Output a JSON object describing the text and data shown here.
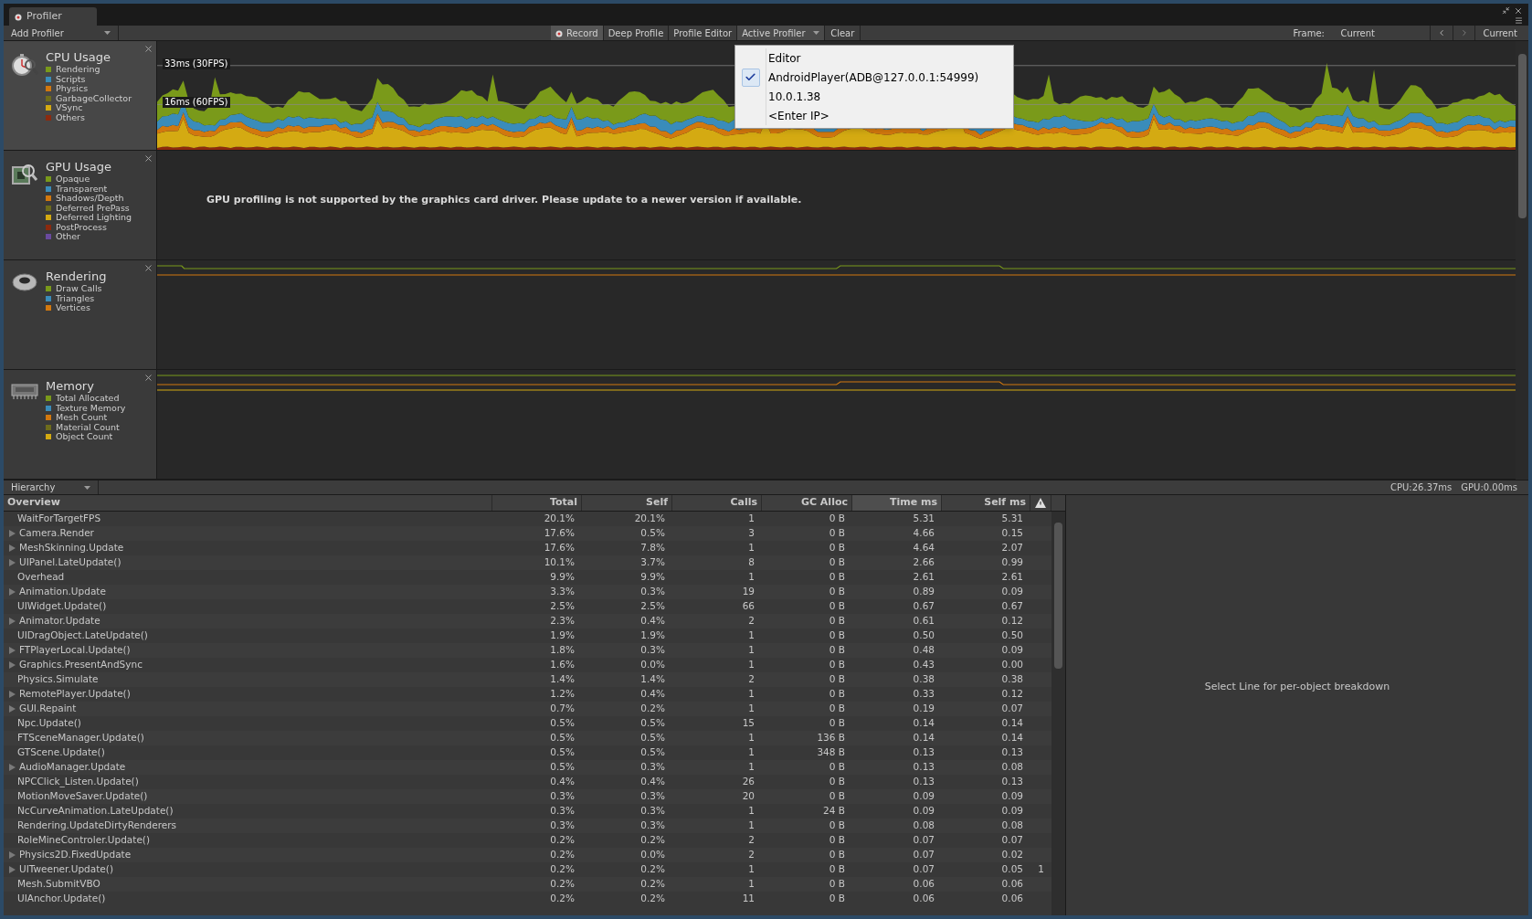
{
  "window": {
    "tab_title": "Profiler"
  },
  "toolbar": {
    "add_profiler": "Add Profiler",
    "buttons": [
      {
        "label": "Record",
        "on": true
      },
      {
        "label": "Deep Profile",
        "on": false
      },
      {
        "label": "Profile Editor",
        "on": false
      }
    ],
    "active_profiler": {
      "label": "Active Profiler",
      "expanded": true
    },
    "clear": "Clear",
    "frame_label": "Frame:",
    "frame_value": "Current",
    "current_button": "Current"
  },
  "profiler_menu": [
    {
      "label": "Editor",
      "selected": false
    },
    {
      "label": "AndroidPlayer(ADB@127.0.0.1:54999)",
      "selected": true
    },
    {
      "label": "10.0.1.38",
      "selected": false
    },
    {
      "label": "<Enter IP>",
      "selected": false
    }
  ],
  "areas": [
    {
      "kind": "cpu",
      "title": "CPU Usage",
      "chart_labels": [
        "33ms (30FPS)",
        "16ms (60FPS)"
      ],
      "legend": [
        {
          "label": "Rendering",
          "color": "#7a9a1a"
        },
        {
          "label": "Scripts",
          "color": "#3a8cba"
        },
        {
          "label": "Physics",
          "color": "#d2780e"
        },
        {
          "label": "GarbageCollector",
          "color": "#6e6c1c"
        },
        {
          "label": "VSync",
          "color": "#d4aa12"
        },
        {
          "label": "Others",
          "color": "#8c2a0e"
        }
      ]
    },
    {
      "kind": "gpu",
      "title": "GPU Usage",
      "message": "GPU profiling is not supported by the graphics card driver. Please update to a newer version if available.",
      "legend": [
        {
          "label": "Opaque",
          "color": "#7a9a1a"
        },
        {
          "label": "Transparent",
          "color": "#3a8cba"
        },
        {
          "label": "Shadows/Depth",
          "color": "#d2780e"
        },
        {
          "label": "Deferred PrePass",
          "color": "#6e6c1c"
        },
        {
          "label": "Deferred Lighting",
          "color": "#d4aa12"
        },
        {
          "label": "PostProcess",
          "color": "#8c2a0e"
        },
        {
          "label": "Other",
          "color": "#6a4a9e"
        }
      ]
    },
    {
      "kind": "rendering",
      "title": "Rendering",
      "legend": [
        {
          "label": "Draw Calls",
          "color": "#7a9a1a"
        },
        {
          "label": "Triangles",
          "color": "#3a8cba"
        },
        {
          "label": "Vertices",
          "color": "#d2780e"
        }
      ]
    },
    {
      "kind": "memory",
      "title": "Memory",
      "legend": [
        {
          "label": "Total Allocated",
          "color": "#7a9a1a"
        },
        {
          "label": "Texture Memory",
          "color": "#3a8cba"
        },
        {
          "label": "Mesh Count",
          "color": "#d2780e"
        },
        {
          "label": "Material Count",
          "color": "#6e6c1c"
        },
        {
          "label": "Object Count",
          "color": "#d4aa12"
        }
      ]
    }
  ],
  "hierarchy": {
    "view": "Hierarchy",
    "cpu_time": "CPU:26.37ms",
    "gpu_time": "GPU:0.00ms",
    "detail_message": "Select Line for per-object breakdown",
    "columns": [
      {
        "kind": "name",
        "label": "Overview",
        "selected": false
      },
      {
        "kind": "number",
        "label": "Total",
        "selected": false
      },
      {
        "kind": "number",
        "label": "Self",
        "selected": false
      },
      {
        "kind": "number",
        "label": "Calls",
        "selected": false
      },
      {
        "kind": "number",
        "label": "GC Alloc",
        "selected": false
      },
      {
        "kind": "number",
        "label": "Time ms",
        "selected": true
      },
      {
        "kind": "number",
        "label": "Self ms",
        "selected": false
      },
      {
        "kind": "warning",
        "selected": false
      }
    ],
    "rows": [
      {
        "has_children": false,
        "cells": [
          "WaitForTargetFPS",
          "20.1%",
          "20.1%",
          "1",
          "0 B",
          "5.31",
          "5.31"
        ]
      },
      {
        "has_children": true,
        "cells": [
          "Camera.Render",
          "17.6%",
          "0.5%",
          "3",
          "0 B",
          "4.66",
          "0.15"
        ]
      },
      {
        "has_children": true,
        "cells": [
          "MeshSkinning.Update",
          "17.6%",
          "7.8%",
          "1",
          "0 B",
          "4.64",
          "2.07"
        ]
      },
      {
        "has_children": true,
        "cells": [
          "UIPanel.LateUpdate()",
          "10.1%",
          "3.7%",
          "8",
          "0 B",
          "2.66",
          "0.99"
        ]
      },
      {
        "has_children": false,
        "cells": [
          "Overhead",
          "9.9%",
          "9.9%",
          "1",
          "0 B",
          "2.61",
          "2.61"
        ]
      },
      {
        "has_children": true,
        "cells": [
          "Animation.Update",
          "3.3%",
          "0.3%",
          "19",
          "0 B",
          "0.89",
          "0.09"
        ]
      },
      {
        "has_children": false,
        "cells": [
          "UIWidget.Update()",
          "2.5%",
          "2.5%",
          "66",
          "0 B",
          "0.67",
          "0.67"
        ]
      },
      {
        "has_children": true,
        "cells": [
          "Animator.Update",
          "2.3%",
          "0.4%",
          "2",
          "0 B",
          "0.61",
          "0.12"
        ]
      },
      {
        "has_children": false,
        "cells": [
          "UIDragObject.LateUpdate()",
          "1.9%",
          "1.9%",
          "1",
          "0 B",
          "0.50",
          "0.50"
        ]
      },
      {
        "has_children": true,
        "cells": [
          "FTPlayerLocal.Update()",
          "1.8%",
          "0.3%",
          "1",
          "0 B",
          "0.48",
          "0.09"
        ]
      },
      {
        "has_children": true,
        "cells": [
          "Graphics.PresentAndSync",
          "1.6%",
          "0.0%",
          "1",
          "0 B",
          "0.43",
          "0.00"
        ]
      },
      {
        "has_children": false,
        "cells": [
          "Physics.Simulate",
          "1.4%",
          "1.4%",
          "2",
          "0 B",
          "0.38",
          "0.38"
        ]
      },
      {
        "has_children": true,
        "cells": [
          "RemotePlayer.Update()",
          "1.2%",
          "0.4%",
          "1",
          "0 B",
          "0.33",
          "0.12"
        ]
      },
      {
        "has_children": true,
        "cells": [
          "GUI.Repaint",
          "0.7%",
          "0.2%",
          "1",
          "0 B",
          "0.19",
          "0.07"
        ]
      },
      {
        "has_children": false,
        "cells": [
          "Npc.Update()",
          "0.5%",
          "0.5%",
          "15",
          "0 B",
          "0.14",
          "0.14"
        ]
      },
      {
        "has_children": false,
        "cells": [
          "FTSceneManager.Update()",
          "0.5%",
          "0.5%",
          "1",
          "136 B",
          "0.14",
          "0.14"
        ]
      },
      {
        "has_children": false,
        "cells": [
          "GTScene.Update()",
          "0.5%",
          "0.5%",
          "1",
          "348 B",
          "0.13",
          "0.13"
        ]
      },
      {
        "has_children": true,
        "cells": [
          "AudioManager.Update",
          "0.5%",
          "0.3%",
          "1",
          "0 B",
          "0.13",
          "0.08"
        ]
      },
      {
        "has_children": false,
        "cells": [
          "NPCClick_Listen.Update()",
          "0.4%",
          "0.4%",
          "26",
          "0 B",
          "0.13",
          "0.13"
        ]
      },
      {
        "has_children": false,
        "cells": [
          "MotionMoveSaver.Update()",
          "0.3%",
          "0.3%",
          "20",
          "0 B",
          "0.09",
          "0.09"
        ]
      },
      {
        "has_children": false,
        "cells": [
          "NcCurveAnimation.LateUpdate()",
          "0.3%",
          "0.3%",
          "1",
          "24 B",
          "0.09",
          "0.09"
        ]
      },
      {
        "has_children": false,
        "cells": [
          "Rendering.UpdateDirtyRenderers",
          "0.3%",
          "0.3%",
          "1",
          "0 B",
          "0.08",
          "0.08"
        ]
      },
      {
        "has_children": false,
        "cells": [
          "RoleMineControler.Update()",
          "0.2%",
          "0.2%",
          "2",
          "0 B",
          "0.07",
          "0.07"
        ]
      },
      {
        "has_children": true,
        "cells": [
          "Physics2D.FixedUpdate",
          "0.2%",
          "0.0%",
          "2",
          "0 B",
          "0.07",
          "0.02"
        ]
      },
      {
        "has_children": true,
        "cells": [
          "UITweener.Update()",
          "0.2%",
          "0.2%",
          "1",
          "0 B",
          "0.07",
          "0.05"
        ],
        "warnings": "1"
      },
      {
        "has_children": false,
        "cells": [
          "Mesh.SubmitVBO",
          "0.2%",
          "0.2%",
          "1",
          "0 B",
          "0.06",
          "0.06"
        ]
      },
      {
        "has_children": false,
        "cells": [
          "UIAnchor.Update()",
          "0.2%",
          "0.2%",
          "11",
          "0 B",
          "0.06",
          "0.06"
        ]
      }
    ]
  }
}
